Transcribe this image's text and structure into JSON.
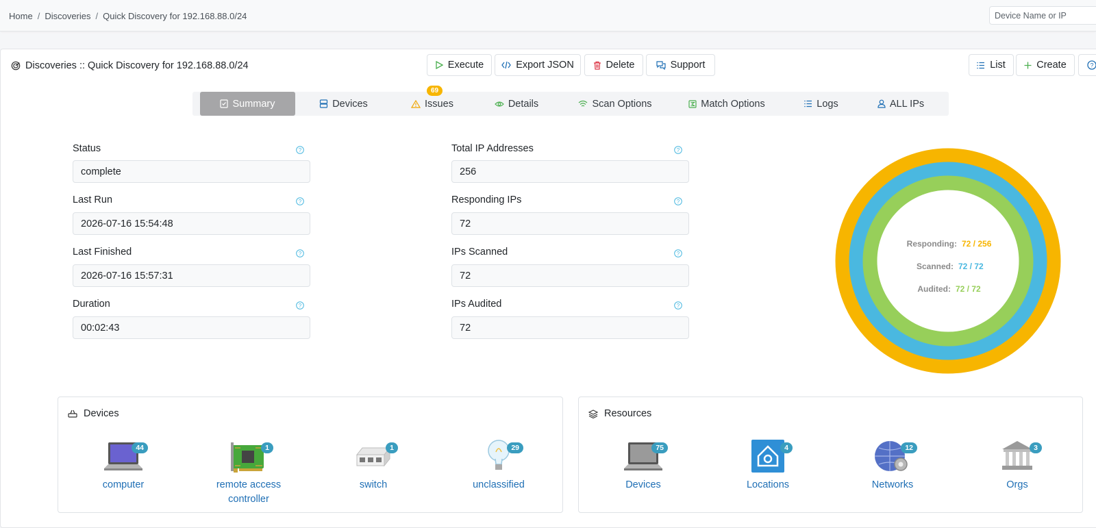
{
  "breadcrumb": [
    "Home",
    "Discoveries",
    "Quick Discovery for 192.168.88.0/24"
  ],
  "search": {
    "placeholder": "Device Name or IP"
  },
  "title": "Discoveries :: Quick Discovery for 192.168.88.0/24",
  "actions": {
    "execute": "Execute",
    "export": "Export JSON",
    "delete": "Delete",
    "support": "Support"
  },
  "right_actions": {
    "list": "List",
    "create": "Create"
  },
  "tabs": [
    {
      "label": "Summary",
      "icon": "summary-icon"
    },
    {
      "label": "Devices",
      "icon": "devices-icon"
    },
    {
      "label": "Issues",
      "icon": "warning-icon",
      "badge": "69"
    },
    {
      "label": "Details",
      "icon": "eye-icon"
    },
    {
      "label": "Scan Options",
      "icon": "wifi-icon"
    },
    {
      "label": "Match Options",
      "icon": "match-icon"
    },
    {
      "label": "Logs",
      "icon": "list-icon"
    },
    {
      "label": "ALL IPs",
      "icon": "user-icon"
    }
  ],
  "fields": {
    "status": {
      "label": "Status",
      "value": "complete"
    },
    "last_run": {
      "label": "Last Run",
      "value": "2026-07-16 15:54:48"
    },
    "last_finished": {
      "label": "Last Finished",
      "value": "2026-07-16 15:57:31"
    },
    "duration": {
      "label": "Duration",
      "value": "00:02:43"
    },
    "total_ips": {
      "label": "Total IP Addresses",
      "value": "256"
    },
    "responding_ips": {
      "label": "Responding IPs",
      "value": "72"
    },
    "ips_scanned": {
      "label": "IPs Scanned",
      "value": "72"
    },
    "ips_audited": {
      "label": "IPs Audited",
      "value": "72"
    }
  },
  "donut": {
    "responding": {
      "label": "Responding:",
      "value": "72 / 256",
      "fraction": 1.0
    },
    "scanned": {
      "label": "Scanned:",
      "value": "72 / 72",
      "fraction": 1.0
    },
    "audited": {
      "label": "Audited:",
      "value": "72 / 72",
      "fraction": 1.0
    }
  },
  "colors": {
    "responding": "#f7b500",
    "scanned": "#4ab8e0",
    "audited": "#97cf5a",
    "link": "#1f6fb5",
    "badge": "#3a9dbf"
  },
  "devices_panel": {
    "title": "Devices",
    "items": [
      {
        "label": "computer",
        "count": "44",
        "icon": "laptop-icon"
      },
      {
        "label": "remote access controller",
        "count": "1",
        "icon": "circuit-board-icon"
      },
      {
        "label": "switch",
        "count": "1",
        "icon": "network-switch-icon"
      },
      {
        "label": "unclassified",
        "count": "29",
        "icon": "lightbulb-icon"
      }
    ]
  },
  "resources_panel": {
    "title": "Resources",
    "items": [
      {
        "label": "Devices",
        "count": "75",
        "icon": "laptop-icon"
      },
      {
        "label": "Locations",
        "count": "4",
        "icon": "location-house-icon"
      },
      {
        "label": "Networks",
        "count": "12",
        "icon": "globe-gear-icon"
      },
      {
        "label": "Orgs",
        "count": "3",
        "icon": "building-icon"
      }
    ]
  }
}
